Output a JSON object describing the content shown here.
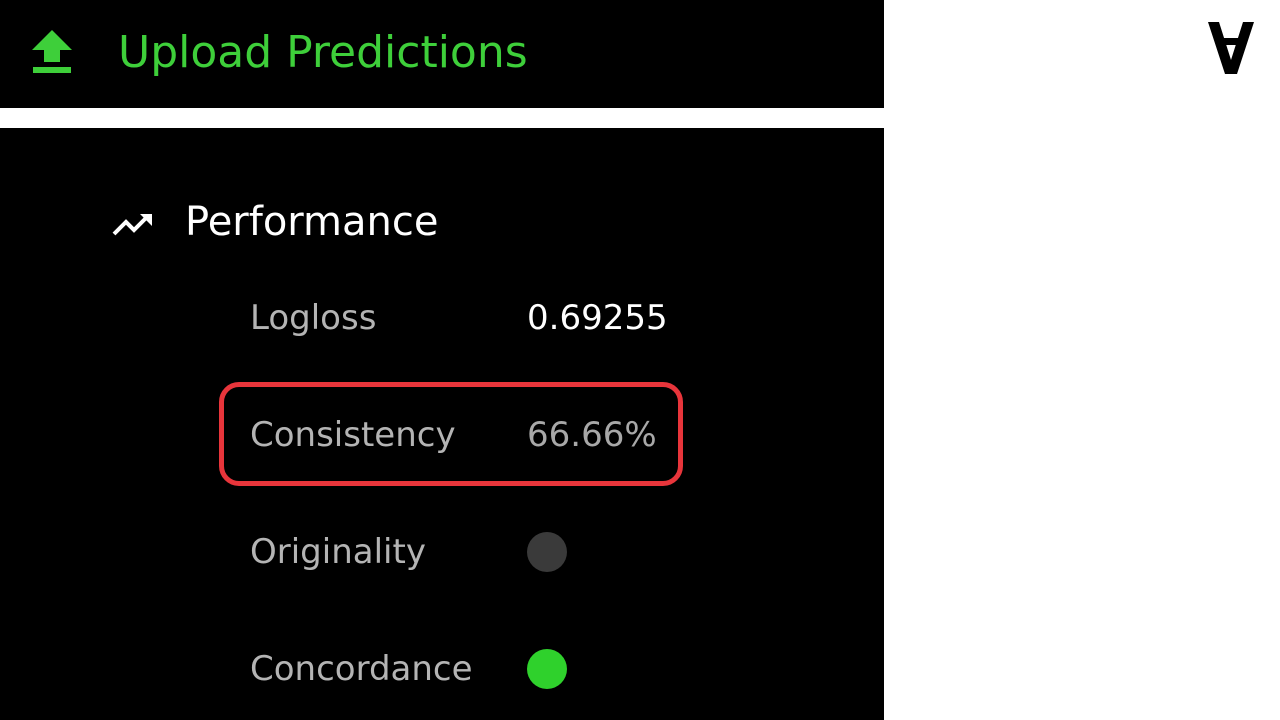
{
  "upload": {
    "label": "Upload Predictions",
    "icon": "upload-arrow-icon",
    "color": "#3ecf3a"
  },
  "performance": {
    "title": "Performance",
    "icon": "trending-up-icon",
    "metrics": [
      {
        "label": "Logloss",
        "value": "0.69255"
      },
      {
        "label": "Consistency",
        "value": "66.66%"
      },
      {
        "label": "Originality",
        "status_color": "#3a3a3a"
      },
      {
        "label": "Concordance",
        "status_color": "#2fd12c"
      }
    ],
    "highlight_color": "#e8353b"
  },
  "logo": {
    "icon": "turned-a-logo-icon",
    "glyph": "∀"
  }
}
